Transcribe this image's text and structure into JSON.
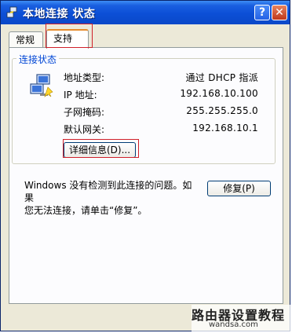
{
  "window": {
    "title": "本地连接 状态"
  },
  "titlebar": {
    "help_glyph": "?",
    "close_glyph": "✕"
  },
  "tabs": [
    {
      "label": "常规"
    },
    {
      "label": "支持"
    }
  ],
  "group": {
    "legend": "连接状态",
    "icon": "network-connection-icon",
    "rows": [
      {
        "label": "地址类型:",
        "value": "通过 DHCP 指派"
      },
      {
        "label": "IP 地址:",
        "value": "192.168.10.100"
      },
      {
        "label": "子网掩码:",
        "value": "255.255.255.0"
      },
      {
        "label": "默认网关:",
        "value": "192.168.10.1"
      }
    ],
    "details_button": "详细信息(D)..."
  },
  "info": {
    "text_line1": "Windows 没有检测到此连接的问题。如果",
    "text_line2": "您无法连接，请单击“修复”。",
    "repair_button": "修复(P)"
  },
  "watermark": {
    "main": "路由器设置教程",
    "sub": "wandsa.com"
  },
  "colors": {
    "title_bar": "#0c4fd6",
    "legend": "#0046d5",
    "highlight": "#d0202a",
    "tab_accent": "#e68b2c"
  }
}
